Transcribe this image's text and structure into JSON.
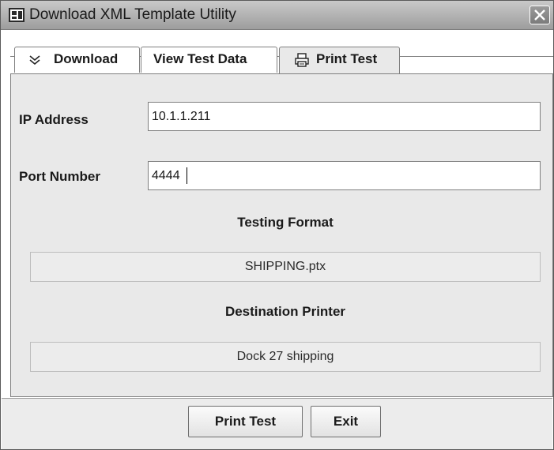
{
  "window": {
    "title": "Download XML Template Utility"
  },
  "tabs": [
    {
      "label": "Download",
      "icon": "chevrons-down-icon",
      "selected": false
    },
    {
      "label": "View Test Data",
      "selected": false
    },
    {
      "label": "Print Test",
      "icon": "printer-icon",
      "selected": true
    }
  ],
  "form": {
    "ip_label": "IP Address",
    "ip_value": "10.1.1.211",
    "port_label": "Port Number",
    "port_value": "4444",
    "testing_format_heading": "Testing Format",
    "testing_format_value": "SHIPPING.ptx",
    "destination_printer_heading": "Destination Printer",
    "destination_printer_value": "Dock 27 shipping"
  },
  "buttons": {
    "print_test": "Print Test",
    "exit": "Exit"
  }
}
